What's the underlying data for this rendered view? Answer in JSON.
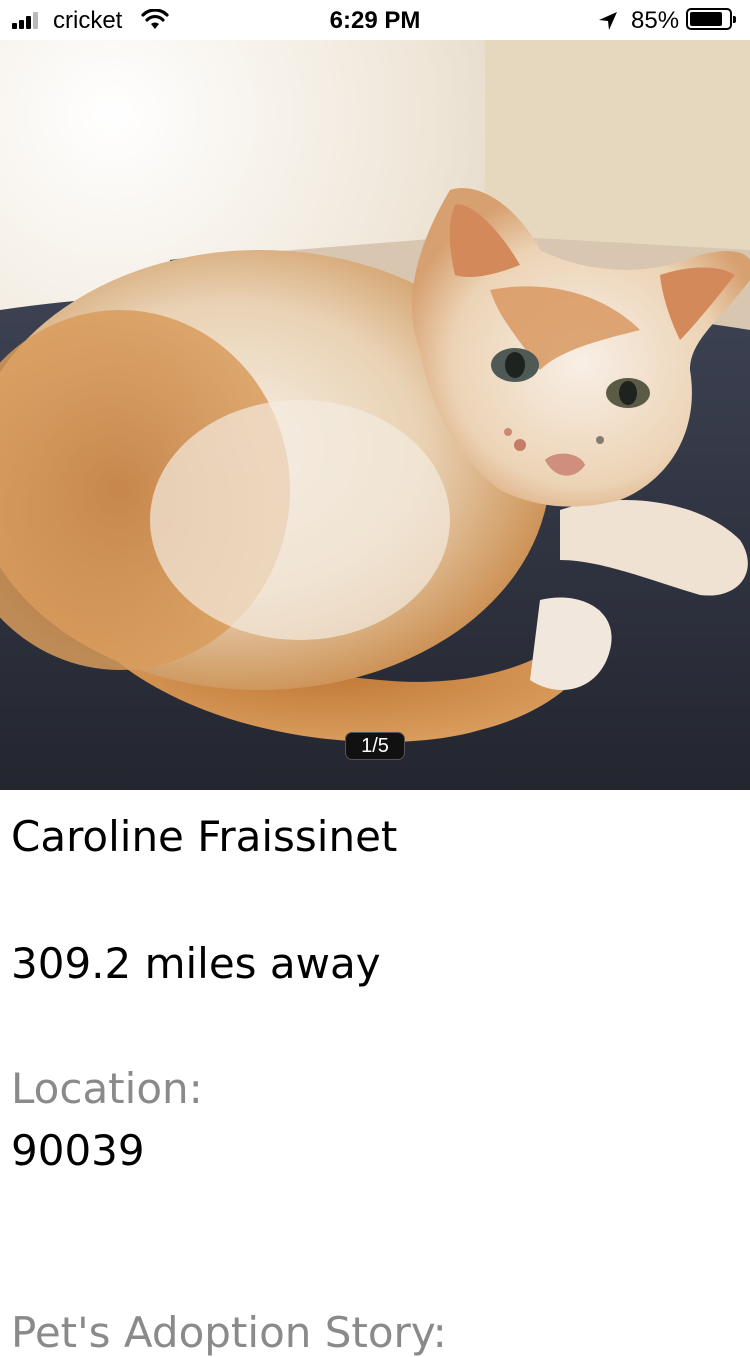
{
  "status_bar": {
    "carrier": "cricket",
    "time": "6:29 PM",
    "battery_percent": "85%",
    "battery_level": 0.85
  },
  "gallery": {
    "counter": "1/5"
  },
  "profile": {
    "name": "Caroline Fraissinet",
    "distance": "309.2 miles away",
    "location_label": "Location:",
    "location_value": "90039",
    "story_label": "Pet's Adoption Story:"
  }
}
